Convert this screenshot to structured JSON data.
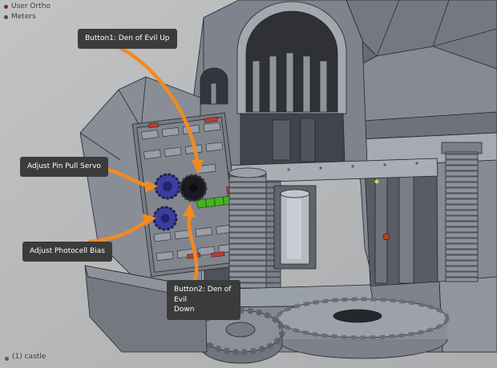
{
  "hud": {
    "view_mode": "User Ortho",
    "units": "Meters",
    "object_info": "(1) castle"
  },
  "callouts": {
    "button1": "Button1: Den of Evil Up",
    "pin_pull_servo": "Adjust Pin Pull Servo",
    "photocell_bias": "Adjust Photocell Bias",
    "button2_line1": "Button2: Den of Evil",
    "button2_line2": "Down"
  },
  "colors": {
    "arrow": "#f18a21",
    "label_bg": "#3b3b3b",
    "label_text": "#ffffff",
    "led_green": "#44b41e",
    "knob_blue": "#3c3e9e",
    "component_red": "#c03a2b",
    "viewport_bg": "#b4b5b7"
  }
}
